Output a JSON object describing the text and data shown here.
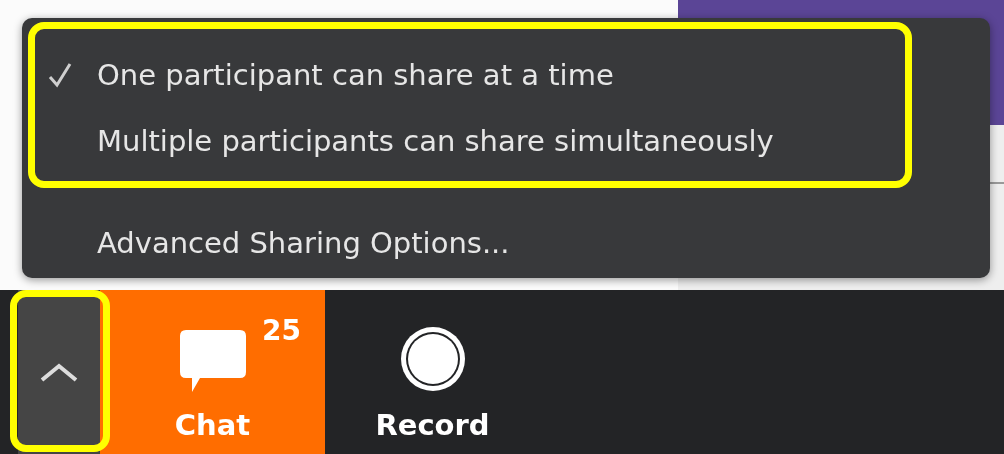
{
  "share_menu": {
    "options": [
      {
        "label": "One participant can share at a time",
        "checked": true
      },
      {
        "label": "Multiple participants can share simultaneously",
        "checked": false
      }
    ],
    "advanced_option": "Advanced Sharing Options..."
  },
  "toolbar": {
    "buttons": [
      {
        "kind": "chat",
        "label": "Chat",
        "badge": "25",
        "active": true
      },
      {
        "kind": "record",
        "label": "Record",
        "active": false
      }
    ]
  }
}
